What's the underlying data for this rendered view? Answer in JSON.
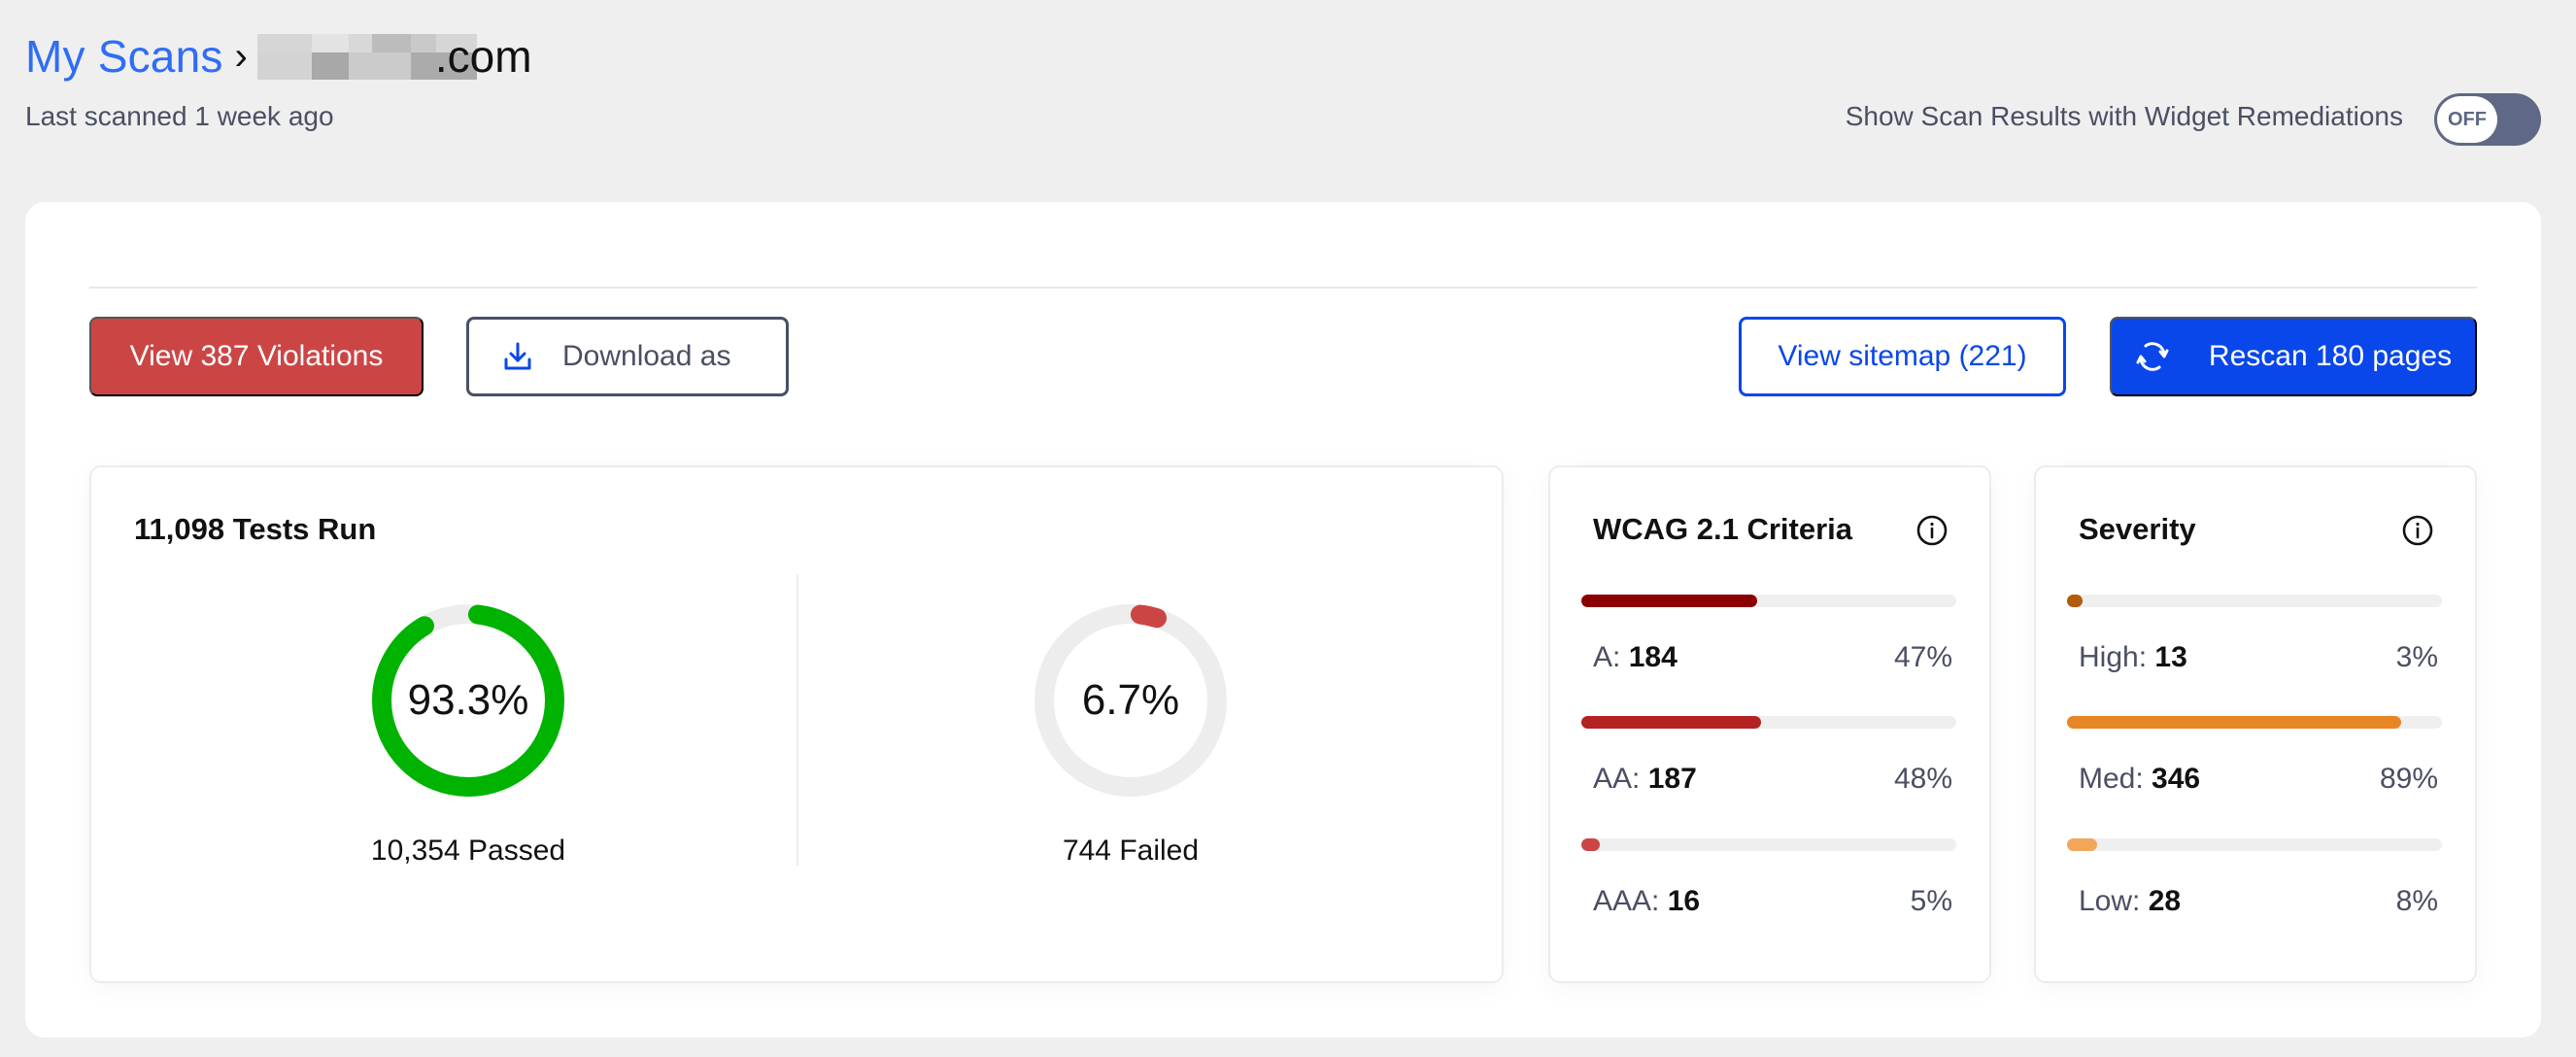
{
  "header": {
    "breadcrumb_root": "My Scans",
    "breadcrumb_separator": "›",
    "domain_suffix": ".com",
    "domain_redacted": true,
    "last_scanned": "Last scanned 1 week ago",
    "toggle_label": "Show Scan Results with Widget Remediations",
    "toggle_state": "OFF"
  },
  "toolbar": {
    "violations_label": "View 387 Violations",
    "download_label": "Download as",
    "sitemap_label": "View sitemap (221)",
    "rescan_label": "Rescan 180 pages"
  },
  "tests": {
    "title": "11,098 Tests Run",
    "passed": {
      "percent_label": "93.3%",
      "percent": 93.3,
      "caption": "10,354 Passed",
      "color": "#00b300"
    },
    "failed": {
      "percent_label": "6.7%",
      "percent": 6.7,
      "caption": "744 Failed",
      "color": "#cc4545"
    },
    "track_color": "#ededed"
  },
  "wcag": {
    "title": "WCAG 2.1 Criteria",
    "items": [
      {
        "label": "A:",
        "count": "184",
        "percent_label": "47%",
        "percent": 47,
        "color": "#8b0000"
      },
      {
        "label": "AA:",
        "count": "187",
        "percent_label": "48%",
        "percent": 48,
        "color": "#b52222"
      },
      {
        "label": "AAA:",
        "count": "16",
        "percent_label": "5%",
        "percent": 5,
        "color": "#cc4545"
      }
    ]
  },
  "severity": {
    "title": "Severity",
    "items": [
      {
        "label": "High:",
        "count": "13",
        "percent_label": "3%",
        "percent": 3,
        "color": "#b35a0b"
      },
      {
        "label": "Med:",
        "count": "346",
        "percent_label": "89%",
        "percent": 89,
        "color": "#e88626"
      },
      {
        "label": "Low:",
        "count": "28",
        "percent_label": "8%",
        "percent": 8,
        "color": "#f2a65a"
      }
    ]
  }
}
